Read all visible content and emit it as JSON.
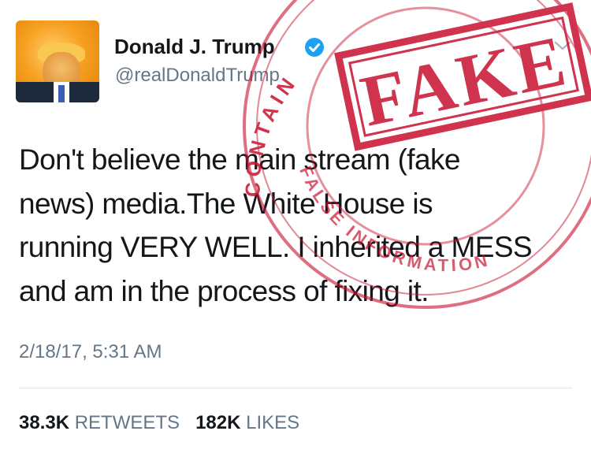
{
  "profile": {
    "display_name": "Donald J. Trump",
    "handle": "@realDonaldTrump",
    "avatar_icon": "profile-photo",
    "verified_icon": "verified-badge-icon",
    "menu_icon": "chevron-down-icon"
  },
  "tweet": {
    "lines": [
      "Don't believe the main stream (fake",
      "news) media.The White House is",
      "running VERY WELL. I inherited a MESS",
      "and am in the process of fixing it."
    ],
    "timestamp": "2/18/17, 5:31 AM"
  },
  "stats": {
    "retweets_count": "38.3K",
    "retweets_label": "RETWEETS",
    "likes_count": "182K",
    "likes_label": "LIKES"
  },
  "stamp": {
    "word": "FAKE",
    "ring_text_top": "CONTAIN",
    "ring_text_bottom": "FALSE INFORMATION",
    "color": "#c8102e"
  },
  "colors": {
    "primary_text": "#14171a",
    "secondary_text": "#657786",
    "verified_blue": "#1da1f2",
    "divider": "#e1e8ed"
  }
}
